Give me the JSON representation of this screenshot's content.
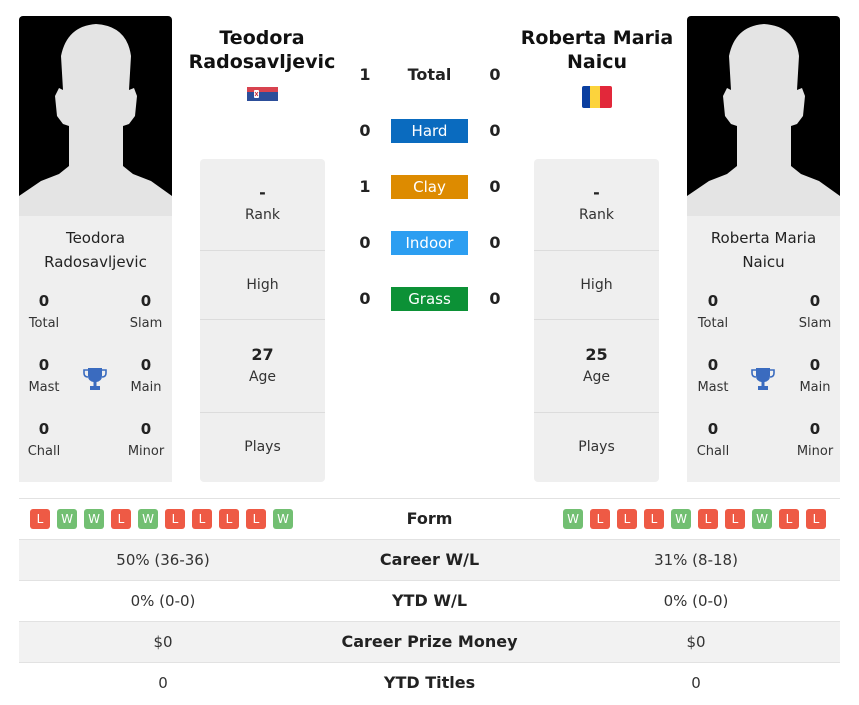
{
  "player1": {
    "name": "Teodora Radosavljevic",
    "name_line1": "Teodora",
    "name_line2": "Radosavljevic",
    "flag": "serbia-flag",
    "titles": {
      "total": "0",
      "slam": "0",
      "mast": "0",
      "main": "0",
      "chall": "0",
      "minor": "0"
    },
    "rank": "-",
    "high": "",
    "age": "27",
    "plays": "",
    "form": [
      "L",
      "W",
      "W",
      "L",
      "W",
      "L",
      "L",
      "L",
      "L",
      "W"
    ],
    "career_wl": "50% (36-36)",
    "ytd_wl": "0% (0-0)",
    "prize_money": "$0",
    "ytd_titles": "0"
  },
  "player2": {
    "name": "Roberta Maria Naicu",
    "name_line1": "Roberta Maria",
    "name_line2": "Naicu",
    "flag": "romania-flag",
    "titles": {
      "total": "0",
      "slam": "0",
      "mast": "0",
      "main": "0",
      "chall": "0",
      "minor": "0"
    },
    "rank": "-",
    "high": "",
    "age": "25",
    "plays": "",
    "form": [
      "W",
      "L",
      "L",
      "L",
      "W",
      "L",
      "L",
      "W",
      "L",
      "L"
    ],
    "career_wl": "31% (8-18)",
    "ytd_wl": "0% (0-0)",
    "prize_money": "$0",
    "ytd_titles": "0"
  },
  "labels": {
    "total": "Total",
    "slam": "Slam",
    "mast": "Mast",
    "main": "Main",
    "chall": "Chall",
    "minor": "Minor",
    "rank": "Rank",
    "high": "High",
    "age": "Age",
    "plays": "Plays",
    "form": "Form",
    "career_wl": "Career W/L",
    "ytd_wl": "YTD W/L",
    "prize_money": "Career Prize Money",
    "ytd_titles": "YTD Titles"
  },
  "h2h": {
    "total": {
      "label": "Total",
      "p1": "1",
      "p2": "0"
    },
    "surfaces": [
      {
        "label": "Hard",
        "p1": "0",
        "p2": "0",
        "color": "#0a6bbf"
      },
      {
        "label": "Clay",
        "p1": "1",
        "p2": "0",
        "color": "#dd8b00"
      },
      {
        "label": "Indoor",
        "p1": "0",
        "p2": "0",
        "color": "#2c9ef1"
      },
      {
        "label": "Grass",
        "p1": "0",
        "p2": "0",
        "color": "#0c9136"
      }
    ]
  },
  "colors": {
    "win": "#72bf72",
    "loss": "#ee5a45",
    "trophy": "#3a6bbf"
  }
}
